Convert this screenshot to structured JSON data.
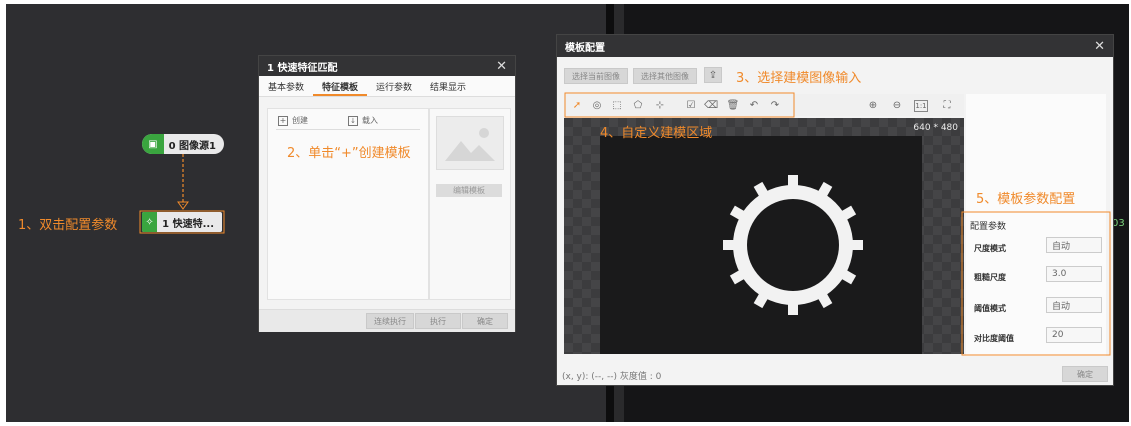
{
  "workspace": {
    "node_source_label": "0 图像源1",
    "node_match_label": "1 快速特...",
    "annotation_1": "1、双击配置参数"
  },
  "match_dialog": {
    "title": "1 快速特征匹配",
    "close": "✕",
    "tabs": [
      "基本参数",
      "特征模板",
      "运行参数",
      "结果显示"
    ],
    "active_tab": "特征模板",
    "create_label": "创建",
    "import_label": "载入",
    "edit_template_label": "编辑模板",
    "annotation_2": "2、单击“+”创建模板",
    "footer_buttons": [
      "连续执行",
      "执行",
      "确定"
    ]
  },
  "template_dialog": {
    "title": "模板配置",
    "close": "✕",
    "btn_select_current": "选择当前图像",
    "btn_select_other": "选择其他图像",
    "annotation_3": "3、选择建模图像输入",
    "annotation_4": "4、自定义建模区域",
    "annotation_5": "5、模板参数配置",
    "image_size": "640 * 480",
    "status": "(x, y): (--, --) 灰度值 : 0",
    "confirm": "确定",
    "params": {
      "section_title": "配置参数",
      "rows": [
        {
          "label": "尺度模式",
          "value": "自动"
        },
        {
          "label": "粗糙尺度",
          "value": "3.0"
        },
        {
          "label": "阈值模式",
          "value": "自动"
        },
        {
          "label": "对比度阈值",
          "value": "20"
        }
      ]
    }
  },
  "colors": {
    "accent": "#f08a2b",
    "node_green": "#3aa53f",
    "workspace_bg": "#2e2e31"
  },
  "edge_text": "03"
}
